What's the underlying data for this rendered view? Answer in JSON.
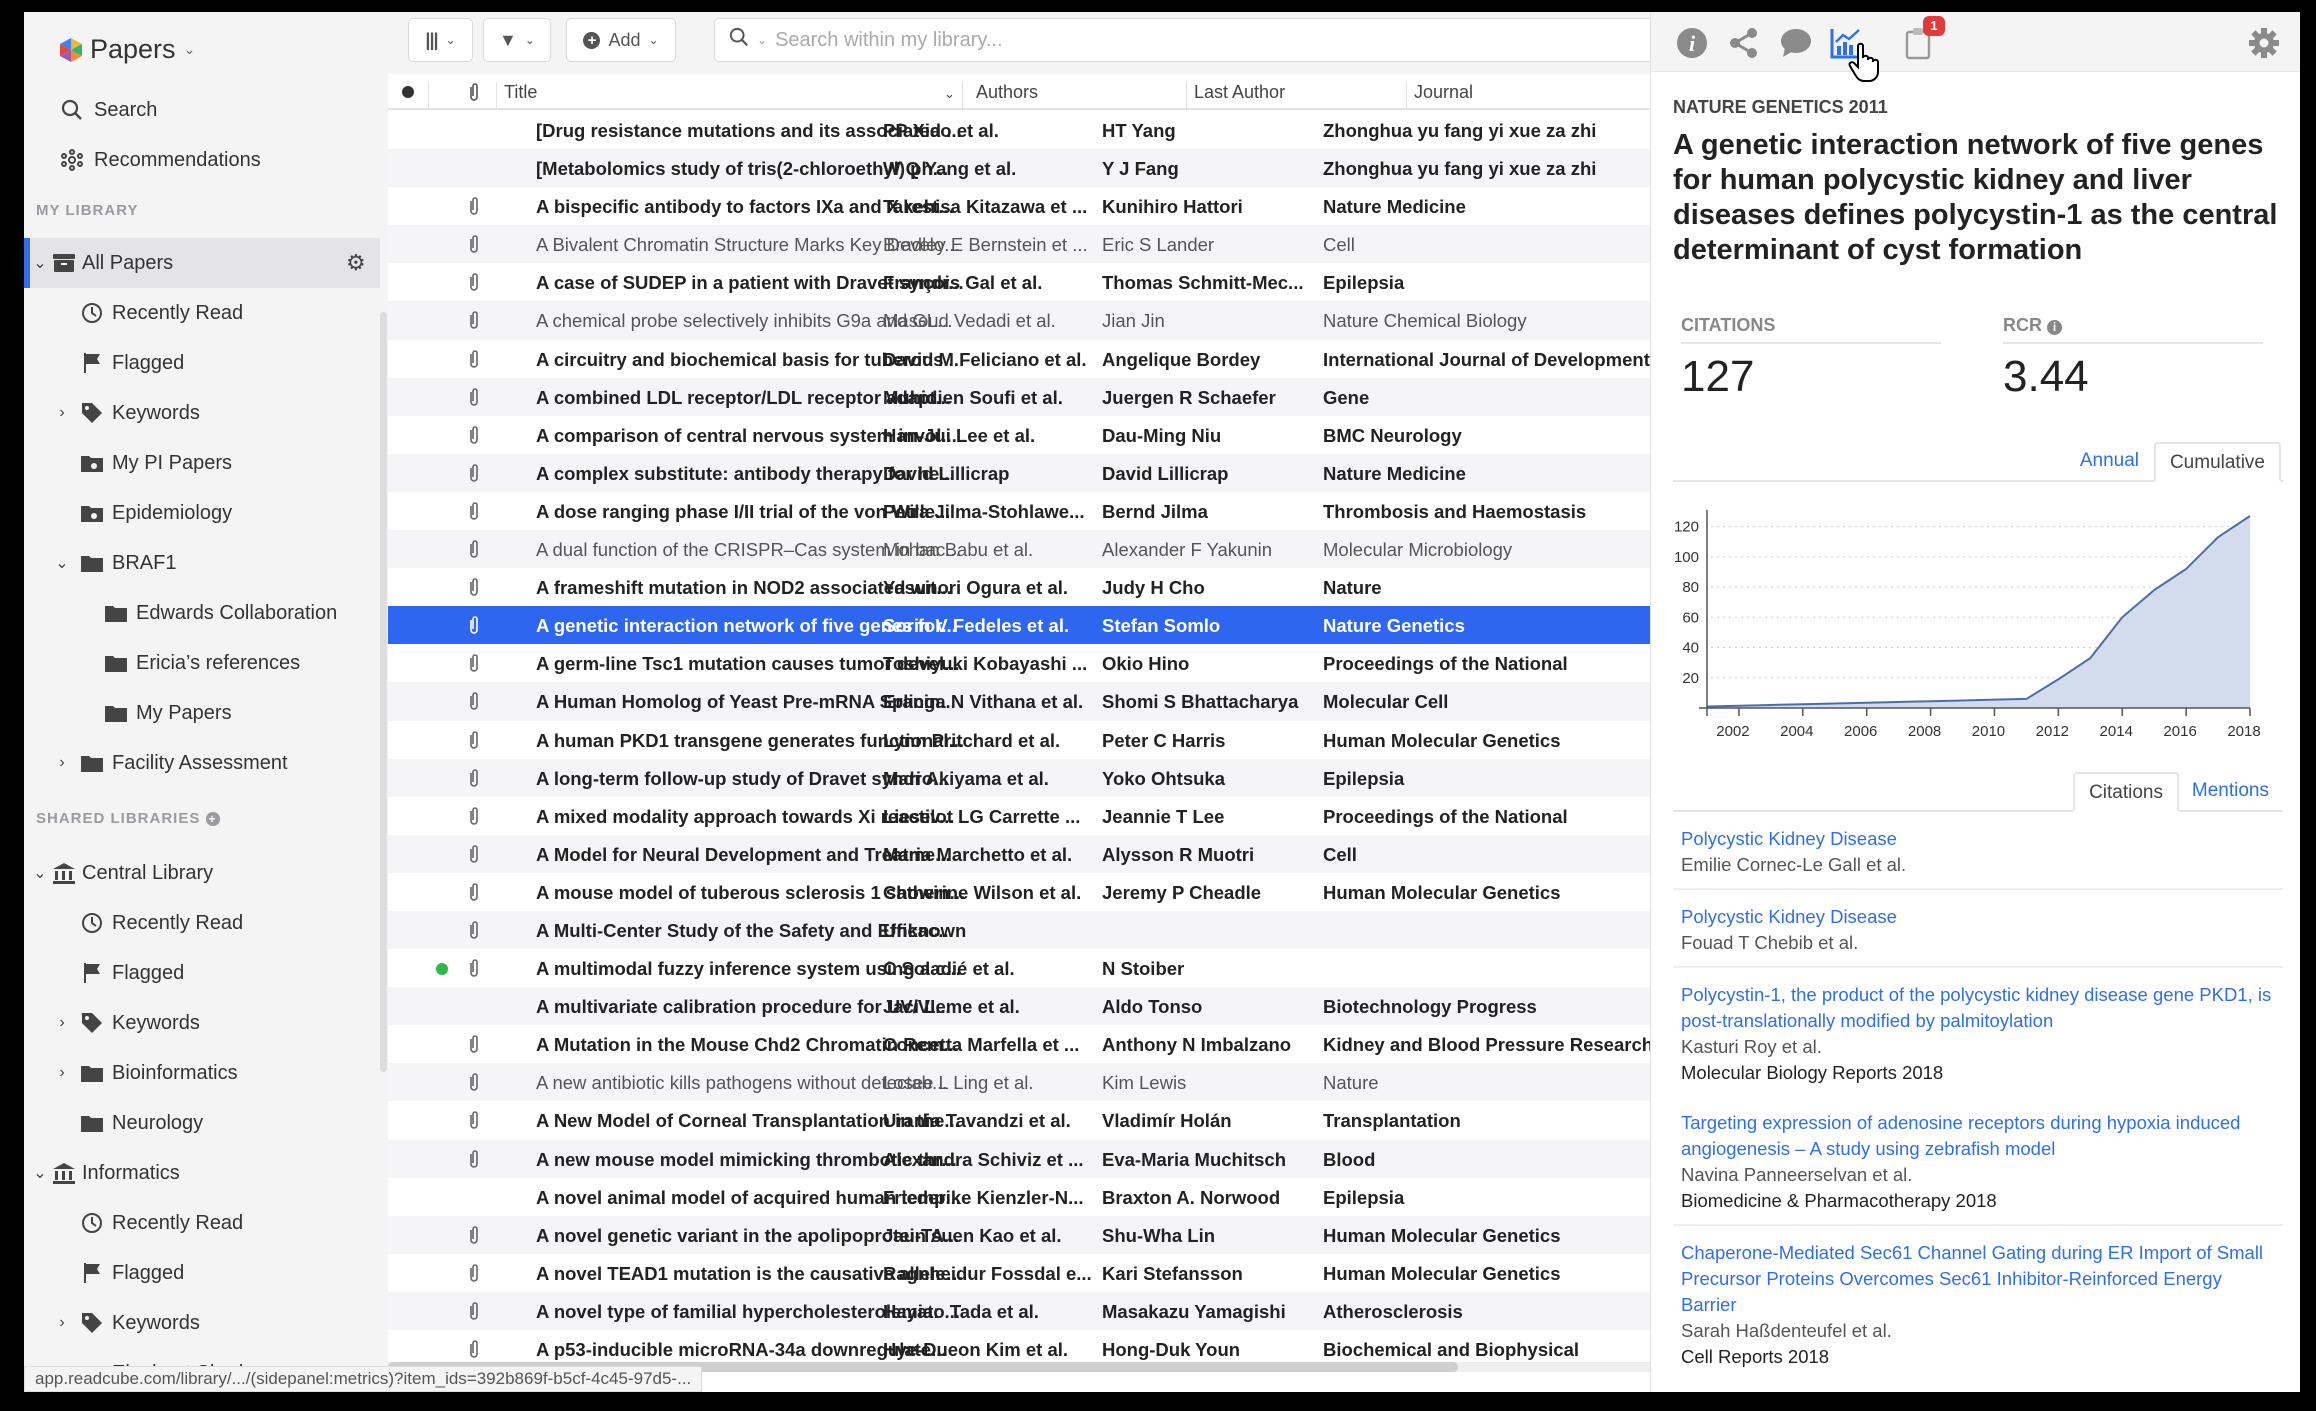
{
  "app": {
    "name": "Papers",
    "status_url": "app.readcube.com/library/.../(sidepanel:metrics)?item_ids=392b869f-b5cf-4c45-97d5-..."
  },
  "sidebar": {
    "top": [
      {
        "label": "Search",
        "icon": "search-icon"
      },
      {
        "label": "Recommendations",
        "icon": "recommendations-icon"
      }
    ],
    "my_library_heading": "MY LIBRARY",
    "shared_heading": "SHARED LIBRARIES",
    "items": [
      {
        "label": "All Papers",
        "icon": "archive",
        "level": 0,
        "chev": "down",
        "active": true,
        "gear": true
      },
      {
        "label": "Recently Read",
        "icon": "clock",
        "level": 1
      },
      {
        "label": "Flagged",
        "icon": "flag",
        "level": 1
      },
      {
        "label": "Keywords",
        "icon": "tag",
        "level": 1,
        "chev": "right"
      },
      {
        "label": "My PI Papers",
        "icon": "shared-folder",
        "level": 1
      },
      {
        "label": "Epidemiology",
        "icon": "shared-folder",
        "level": 1
      },
      {
        "label": "BRAF1",
        "icon": "folder",
        "level": 1,
        "chev": "down"
      },
      {
        "label": "Edwards Collaboration",
        "icon": "folder",
        "level": 2
      },
      {
        "label": "Ericia’s references",
        "icon": "folder",
        "level": 2
      },
      {
        "label": "My Papers",
        "icon": "folder",
        "level": 2
      },
      {
        "label": "Facility Assessment",
        "icon": "folder",
        "level": 1,
        "chev": "right"
      },
      {
        "heading": true
      },
      {
        "label": "Central Library",
        "icon": "library",
        "level": 0,
        "chev": "down"
      },
      {
        "label": "Recently Read",
        "icon": "clock",
        "level": 1
      },
      {
        "label": "Flagged",
        "icon": "flag",
        "level": 1
      },
      {
        "label": "Keywords",
        "icon": "tag",
        "level": 1,
        "chev": "right"
      },
      {
        "label": "Bioinformatics",
        "icon": "folder",
        "level": 1,
        "chev": "right"
      },
      {
        "label": "Neurology",
        "icon": "folder",
        "level": 1
      },
      {
        "label": "Informatics",
        "icon": "library",
        "level": 0,
        "chev": "down"
      },
      {
        "label": "Recently Read",
        "icon": "clock",
        "level": 1
      },
      {
        "label": "Flagged",
        "icon": "flag",
        "level": 1
      },
      {
        "label": "Keywords",
        "icon": "tag",
        "level": 1,
        "chev": "right"
      },
      {
        "label": "Elephant Sharks",
        "icon": "folder",
        "level": 1
      }
    ]
  },
  "toolbar": {
    "add_label": "Add",
    "search_placeholder": "Search within my library..."
  },
  "table": {
    "columns": {
      "title": "Title",
      "authors": "Authors",
      "last_author": "Last Author",
      "journal": "Journal"
    },
    "rows": [
      {
        "title": "[Drug resistance mutations and its associated ...",
        "authors": "PP Xiao et al.",
        "last": "HT Yang",
        "journal": "Zhonghua yu fang yi xue za zhi",
        "clip": false
      },
      {
        "title": "[Metabolomics study of tris(2-chloroethyl) ph...",
        "authors": "W Q Yang et al.",
        "last": "Y J Fang",
        "journal": "Zhonghua yu fang yi xue za zhi",
        "clip": false
      },
      {
        "title": "A bispecific antibody to factors IXa and X rest...",
        "authors": "Takehisa Kitazawa et ...",
        "last": "Kunihiro Hattori",
        "journal": "Nature Medicine",
        "clip": true
      },
      {
        "title": "A Bivalent Chromatin Structure Marks Key Develo...",
        "authors": "Bradley E Bernstein et ...",
        "last": "Eric S Lander",
        "journal": "Cell",
        "clip": true,
        "read": true
      },
      {
        "title": "A case of SUDEP in a patient with Dravet syndr...",
        "authors": "François Gal et al.",
        "last": "Thomas Schmitt-Mec...",
        "journal": "Epilepsia",
        "clip": true
      },
      {
        "title": "A chemical probe selectively inhibits G9a and GL...",
        "authors": "Masoud Vedadi et al.",
        "last": "Jian Jin",
        "journal": "Nature Chemical Biology",
        "clip": true,
        "read": true
      },
      {
        "title": "A circuitry and biochemical basis for tuberous...",
        "authors": "David M Feliciano et al.",
        "last": "Angelique Bordey",
        "journal": "International Journal of Developmental",
        "clip": true
      },
      {
        "title": "A combined LDL receptor/LDL receptor adapt...",
        "authors": "Muhidien Soufi et al.",
        "last": "Juergen R Schaefer",
        "journal": "Gene",
        "clip": true
      },
      {
        "title": "A comparison of central nervous system invol...",
        "authors": "Han-Jui Lee et al.",
        "last": "Dau-Ming Niu",
        "journal": "BMC Neurology",
        "clip": true
      },
      {
        "title": "A complex substitute: antibody therapy for he...",
        "authors": "David Lillicrap",
        "last": "David Lillicrap",
        "journal": "Nature Medicine",
        "clip": true
      },
      {
        "title": "A dose ranging phase I/II trial of the von Wille...",
        "authors": "Petra Jilma-Stohlawe...",
        "last": "Bernd Jilma",
        "journal": "Thrombosis and Haemostasis",
        "clip": true
      },
      {
        "title": "A dual function of the CRISPR–Cas system in bac...",
        "authors": "Mohan Babu et al.",
        "last": "Alexander F Yakunin",
        "journal": "Molecular Microbiology",
        "clip": true,
        "read": true
      },
      {
        "title": "A frameshift mutation in NOD2 associated wit...",
        "authors": "Yasunori Ogura et al.",
        "last": "Judy H Cho",
        "journal": "Nature",
        "clip": true
      },
      {
        "title": "A genetic interaction network of five genes for...",
        "authors": "Sorin V Fedeles et al.",
        "last": "Stefan Somlo",
        "journal": "Nature Genetics",
        "clip": true,
        "selected": true
      },
      {
        "title": "A germ-line Tsc1 mutation causes tumor devel...",
        "authors": "Toshiyuki Kobayashi ...",
        "last": "Okio Hino",
        "journal": "Proceedings of the National",
        "clip": true
      },
      {
        "title": "A Human Homolog of Yeast Pre-mRNA Splicin...",
        "authors": "Eranga N Vithana et al.",
        "last": "Shomi S Bhattacharya",
        "journal": "Molecular Cell",
        "clip": true
      },
      {
        "title": "A human PKD1 transgene generates functional...",
        "authors": "Lynn Pritchard et al.",
        "last": "Peter C Harris",
        "journal": "Human Molecular Genetics",
        "clip": true
      },
      {
        "title": "A long-term follow-up study of Dravet syndro...",
        "authors": "Mari Akiyama et al.",
        "last": "Yoko Ohtsuka",
        "journal": "Epilepsia",
        "clip": true
      },
      {
        "title": "A mixed modality approach towards Xi reactiv...",
        "authors": "Lieselot LG Carrette ...",
        "last": "Jeannie T Lee",
        "journal": "Proceedings of the National",
        "clip": true
      },
      {
        "title": "A Model for Neural Development and Treatme...",
        "authors": "Maria Marchetto et al.",
        "last": "Alysson R Muotri",
        "journal": "Cell",
        "clip": true
      },
      {
        "title": "A mouse model of tuberous sclerosis 1 showin...",
        "authors": "Catherine Wilson et al.",
        "last": "Jeremy P Cheadle",
        "journal": "Human Molecular Genetics",
        "clip": true
      },
      {
        "title": "A Multi-Center Study of the Safety and Efficac...",
        "authors": "Unknown",
        "last": "",
        "journal": "",
        "clip": true
      },
      {
        "title": "A multimodal fuzzy inference system using a c...",
        "authors": "C Soladié et al.",
        "last": "N Stoiber",
        "journal": "",
        "clip": true,
        "dot": true
      },
      {
        "title": "A multivariate calibration procedure for UV/VI...",
        "authors": "Jaci Leme et al.",
        "last": "Aldo Tonso",
        "journal": "Biotechnology Progress",
        "clip": false
      },
      {
        "title": "A Mutation in the Mouse Chd2 Chromatin Rem...",
        "authors": "Concetta Marfella et ...",
        "last": "Anthony N Imbalzano",
        "journal": "Kidney and Blood Pressure Research",
        "clip": true
      },
      {
        "title": "A new antibiotic kills pathogens without detectab...",
        "authors": "Losee L Ling et al.",
        "last": "Kim Lewis",
        "journal": "Nature",
        "clip": true,
        "read": true
      },
      {
        "title": "A New Model of Corneal Transplantation in the...",
        "authors": "Urania Tavandzi et al.",
        "last": "Vladimír Holán",
        "journal": "Transplantation",
        "clip": true
      },
      {
        "title": "A new mouse model mimicking thrombotic thr...",
        "authors": "Alexandra Schiviz et ...",
        "last": "Eva-Maria Muchitsch",
        "journal": "Blood",
        "clip": true
      },
      {
        "title": "A novel animal model of acquired human temp...",
        "authors": "Friederike Kienzler-N...",
        "last": "Braxton A. Norwood",
        "journal": "Epilepsia",
        "clip": false
      },
      {
        "title": "A novel genetic variant in the apolipoprotein A...",
        "authors": "Jau-Tsuen Kao et al.",
        "last": "Shu-Wha Lin",
        "journal": "Human Molecular Genetics",
        "clip": true
      },
      {
        "title": "A novel TEAD1 mutation is the causative allele ...",
        "authors": "Ragnheidur Fossdal e...",
        "last": "Kari Stefansson",
        "journal": "Human Molecular Genetics",
        "clip": true
      },
      {
        "title": "A novel type of familial hypercholesterolemia: ...",
        "authors": "Hayato Tada et al.",
        "last": "Masakazu Yamagishi",
        "journal": "Atherosclerosis",
        "clip": true
      },
      {
        "title": "A p53-inducible microRNA-34a downregulate...",
        "authors": "Hye-Dueon Kim et al.",
        "last": "Hong-Duk Youn",
        "journal": "Biochemical and Biophysical",
        "clip": true
      }
    ]
  },
  "details": {
    "journal_year": "NATURE GENETICS 2011",
    "title": "A genetic interaction network of five genes for human polycystic kidney and liver diseases defines polycystin-1 as the central determinant of cyst formation",
    "citations_label": "CITATIONS",
    "citations_value": "127",
    "rcr_label": "RCR",
    "rcr_value": "3.44",
    "chart_tabs": [
      "Annual",
      "Cumulative"
    ],
    "list_tabs": [
      "Citations",
      "Mentions"
    ],
    "notification_count": "1",
    "citing": [
      {
        "title": "Polycystic Kidney Disease",
        "authors": "Emilie Cornec-Le Gall et al.",
        "journal": ""
      },
      {
        "title": "Polycystic Kidney Disease",
        "authors": "Fouad T Chebib et al.",
        "journal": ""
      },
      {
        "title": "Polycystin-1, the product of the polycystic kidney disease gene PKD1, is post-translationally modified by palmitoylation",
        "authors": "Kasturi Roy et al.",
        "journal": "Molecular Biology Reports 2018"
      },
      {
        "title": "Targeting expression of adenosine receptors during hypoxia induced angiogenesis – A study using zebrafish model",
        "authors": "Navina Panneerselvan et al.",
        "journal": "Biomedicine & Pharmacotherapy 2018"
      },
      {
        "title": "Chaperone-Mediated Sec61 Channel Gating during ER Import of Small Precursor Proteins Overcomes Sec61 Inhibitor-Reinforced Energy Barrier",
        "authors": "Sarah Haßdenteufel et al.",
        "journal": "Cell Reports 2018"
      },
      {
        "title": "Genetic correlation network prediction of forest soil microbial",
        "authors": "",
        "journal": ""
      }
    ]
  },
  "chart_data": {
    "type": "area",
    "title": "Cumulative citations",
    "x": [
      2001,
      2002,
      2003,
      2004,
      2005,
      2006,
      2007,
      2008,
      2009,
      2010,
      2011,
      2012,
      2013,
      2014,
      2015,
      2016,
      2017,
      2018
    ],
    "values": [
      1,
      1.5,
      2,
      2.5,
      3,
      3.5,
      4,
      4.5,
      5,
      5.5,
      6,
      19,
      33,
      60,
      78,
      92,
      113,
      127
    ],
    "xticks": [
      "2002",
      "2004",
      "2006",
      "2008",
      "2010",
      "2012",
      "2014",
      "2016",
      "2018"
    ],
    "yticks": [
      "20",
      "40",
      "60",
      "80",
      "100",
      "120"
    ],
    "xlim": [
      2001,
      2018
    ],
    "ylim": [
      0,
      127
    ],
    "grid": true,
    "colors": {
      "line": "#4a6fa5",
      "fill": "#d3dcec"
    }
  }
}
